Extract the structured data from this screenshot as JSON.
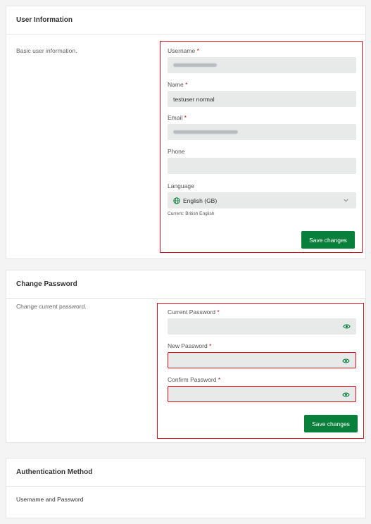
{
  "user_info": {
    "title": "User Information",
    "description": "Basic user information.",
    "username_label": "Username",
    "name_label": "Name",
    "name_value": "testuser normal",
    "email_label": "Email",
    "phone_label": "Phone",
    "language_label": "Language",
    "language_value": "English (GB)",
    "language_current": "Current: British English",
    "required_marker": "*",
    "save_label": "Save changes"
  },
  "change_password": {
    "title": "Change Password",
    "description": "Change current password.",
    "current_label": "Current Password",
    "new_label": "New Password",
    "confirm_label": "Confirm Password",
    "required_marker": "*",
    "save_label": "Save changes"
  },
  "auth_method": {
    "title": "Authentication Method",
    "value": "Username and Password"
  },
  "colors": {
    "accent_green": "#087f3a",
    "highlight_red": "#d6111d",
    "input_bg": "#e8eaea"
  },
  "icons": {
    "language": "globe-icon",
    "dropdown": "chevron-down-icon",
    "password_toggle": "eye-icon"
  }
}
